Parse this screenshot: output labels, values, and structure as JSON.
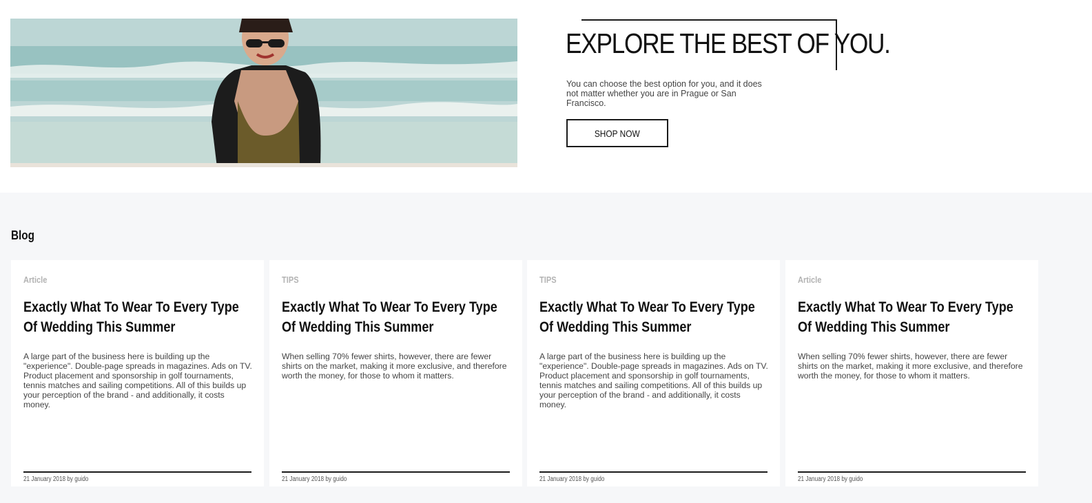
{
  "hero": {
    "image_alt": "Woman in sunglasses on a beach",
    "title": "EXPLORE THE BEST OF YOU.",
    "text": "You can choose the best option for you, and it does not matter whether you are in Prague or San Francisco.",
    "button_label": "SHOP NOW"
  },
  "blog": {
    "title": "Blog",
    "posts": [
      {
        "category": "Article",
        "title": "Exactly What To Wear To Every Type Of Wedding This Summer",
        "excerpt": "A large part of the business here is building up the \"experience\". Double-page spreads in magazines. Ads on TV. Product placement and sponsorship in golf tournaments, tennis matches and sailing competitions. All of this builds up your perception of the brand - and additionally, it costs money.",
        "meta": "21 January 2018 by guido"
      },
      {
        "category": "TIPS",
        "title": "Exactly What To Wear To Every Type Of Wedding This Summer",
        "excerpt": "When selling 70% fewer shirts, however, there are fewer shirts on the market, making it more exclusive, and therefore worth the money, for those to whom it matters.",
        "meta": "21 January 2018 by guido"
      },
      {
        "category": "TIPS",
        "title": "Exactly What To Wear To Every Type Of Wedding This Summer",
        "excerpt": "A large part of the business here is building up the \"experience\". Double-page spreads in magazines. Ads on TV. Product placement and sponsorship in golf tournaments, tennis matches and sailing competitions. All of this builds up your perception of the brand - and additionally, it costs money.",
        "meta": "21 January 2018 by guido"
      },
      {
        "category": "Article",
        "title": "Exactly What To Wear To Every Type Of Wedding This Summer",
        "excerpt": "When selling 70% fewer shirts, however, there are fewer shirts on the market, making it more exclusive, and therefore worth the money, for those to whom it matters.",
        "meta": "21 January 2018 by guido"
      }
    ]
  }
}
